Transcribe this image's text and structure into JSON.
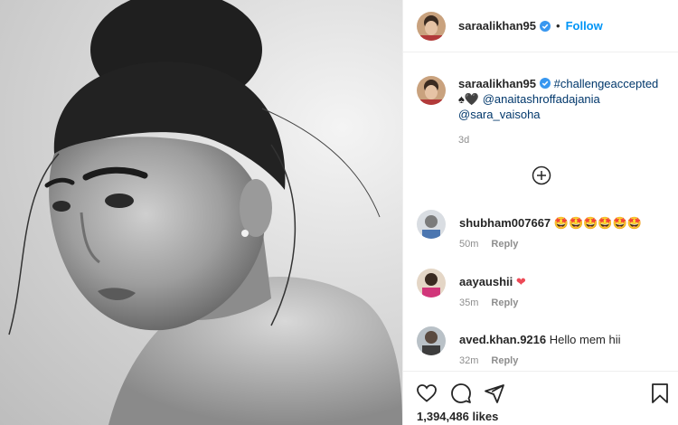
{
  "post": {
    "author": "saraalikhan95",
    "follow_label": "Follow",
    "dot": "•"
  },
  "caption": {
    "username": "saraalikhan95",
    "hashtag": "#challengeaccepted",
    "mention_1": "@anaitashroffadajania",
    "mention_2": "@sara_vaisoha",
    "emoji": "♠🖤",
    "time": "3d"
  },
  "comments": [
    {
      "username": "shubham007667",
      "text": "🤩🤩🤩🤩🤩🤩",
      "time": "50m",
      "reply_label": "Reply"
    },
    {
      "username": "aayaushii",
      "text": "❤",
      "time": "35m",
      "reply_label": "Reply"
    },
    {
      "username": "aved.khan.9216",
      "text": "Hello mem hii",
      "time": "32m",
      "reply_label": "Reply"
    }
  ],
  "likes": {
    "count_text": "1,394,486 likes"
  },
  "icons": {
    "verified": "verified-badge-icon",
    "more": "plus-circle-icon",
    "like": "heart-icon",
    "comment": "comment-bubble-icon",
    "share": "paper-plane-icon",
    "save": "bookmark-icon"
  },
  "colors": {
    "accent": "#0095f6",
    "link": "#00376b",
    "muted": "#8e8e8e",
    "text": "#262626",
    "heart": "#ed4956"
  }
}
